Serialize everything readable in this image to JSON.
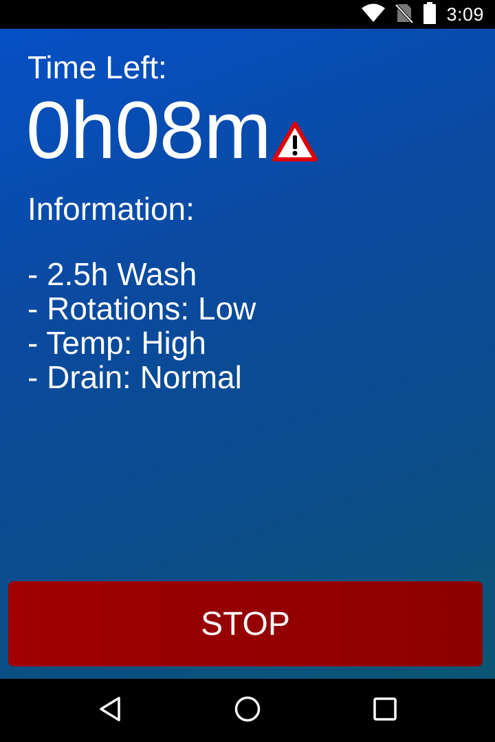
{
  "status_bar": {
    "time": "3:09",
    "icons": [
      "wifi-icon",
      "no-sim-icon",
      "battery-icon"
    ]
  },
  "main": {
    "time_left_label": "Time Left:",
    "time_left_value": "0h08m",
    "warning_icon": "warning-triangle-icon",
    "information_label": "Information:",
    "info_items": [
      "- 2.5h Wash",
      "- Rotations: Low",
      "- Temp: High",
      "- Drain: Normal"
    ]
  },
  "stop_button": {
    "label": "STOP",
    "color": "#990000"
  },
  "nav_bar": {
    "buttons": [
      "back-icon",
      "home-icon",
      "recents-icon"
    ]
  },
  "colors": {
    "background_top": "#0550c6",
    "background_bottom": "#0b5673",
    "text": "#ffffff",
    "warning": "#e00000"
  }
}
